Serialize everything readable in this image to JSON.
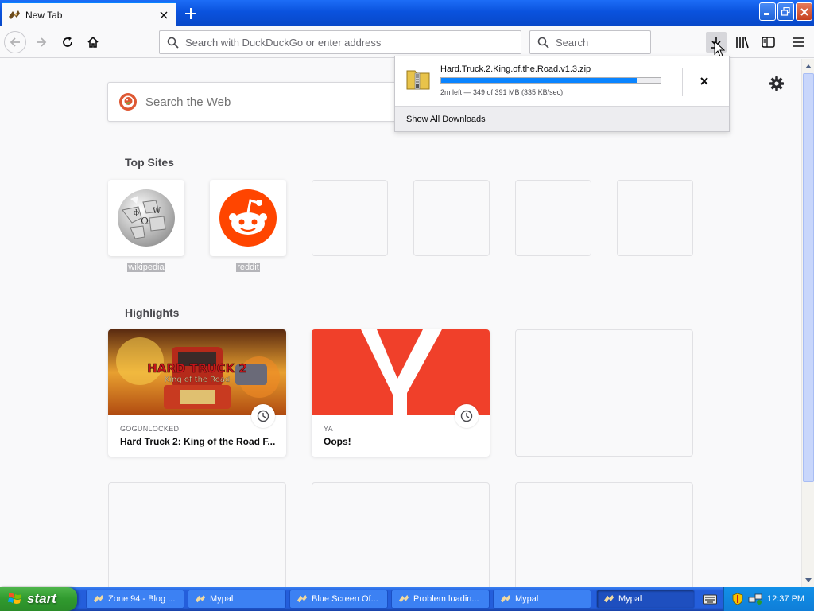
{
  "tab": {
    "title": "New Tab",
    "close_icon": "close-icon"
  },
  "navbar": {
    "url_placeholder": "Search with DuckDuckGo or enter address",
    "search_placeholder": "Search"
  },
  "newtab": {
    "search_placeholder": "Search the Web",
    "top_sites_heading": "Top Sites",
    "highlights_heading": "Highlights",
    "top_sites": [
      {
        "label": "wikipedia"
      },
      {
        "label": "reddit"
      }
    ],
    "highlights": [
      {
        "source": "GOGUNLOCKED",
        "title": "Hard Truck 2: King of the Road F...",
        "image_caption_1": "HARD TRUCK 2",
        "image_caption_2": "King of the Road"
      },
      {
        "source": "YA",
        "title": "Oops!"
      }
    ]
  },
  "downloads": {
    "file_name": "Hard.Truck.2.King.of.the.Road.v1.3.zip",
    "status": "2m left — 349 of 391 MB (335 KB/sec)",
    "progress_fraction": 0.8926,
    "show_all": "Show All Downloads"
  },
  "taskbar": {
    "start_label": "start",
    "tasks": [
      {
        "label": "Zone 94 - Blog ..."
      },
      {
        "label": "Mypal"
      },
      {
        "label": "Blue Screen Of..."
      },
      {
        "label": "Problem loadin..."
      },
      {
        "label": "Mypal"
      },
      {
        "label": "Mypal"
      }
    ],
    "clock": "12:37 PM"
  },
  "colors": {
    "accent": "#0a84ff",
    "reddit": "#ff4500",
    "ya": "#f0402a",
    "xp_blue": "#245edb",
    "start_green": "#309a2e"
  }
}
